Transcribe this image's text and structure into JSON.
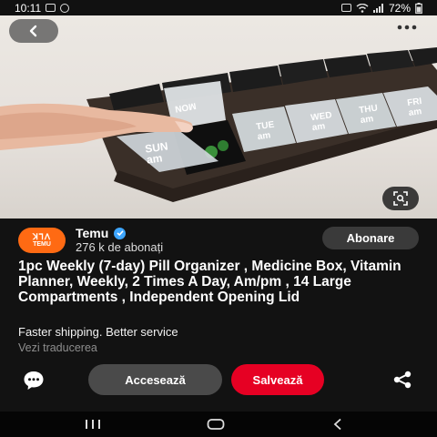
{
  "status_bar": {
    "time": "10:11",
    "battery": "72%"
  },
  "pin": {
    "creator": {
      "name": "Temu",
      "avatar_text_top": "ꓘꓶꓥ",
      "avatar_text_bottom": "TEMU",
      "followers": "276 k de abonați"
    },
    "follow_label": "Abonare",
    "title": "1pc Weekly (7-day) Pill Organizer , Medicine Box, Vitamin Planner, Weekly, 2 Times A Day, Am/pm , 14 Large Compartments , Independent Opening Lid",
    "description": "Faster shipping. Better service",
    "translate_label": "Vezi traducerea"
  },
  "product_labels": [
    "SUN am",
    "MON",
    "TUE am",
    "WED am",
    "THU am",
    "FRI am"
  ],
  "actions": {
    "visit_label": "Accesează",
    "save_label": "Salvează"
  },
  "colors": {
    "save": "#e60023",
    "brand": "#ff6a13",
    "verified": "#3ea6ff"
  },
  "icons": [
    "back-arrow-icon",
    "more-icon",
    "visual-search-icon",
    "comment-icon",
    "share-icon"
  ]
}
